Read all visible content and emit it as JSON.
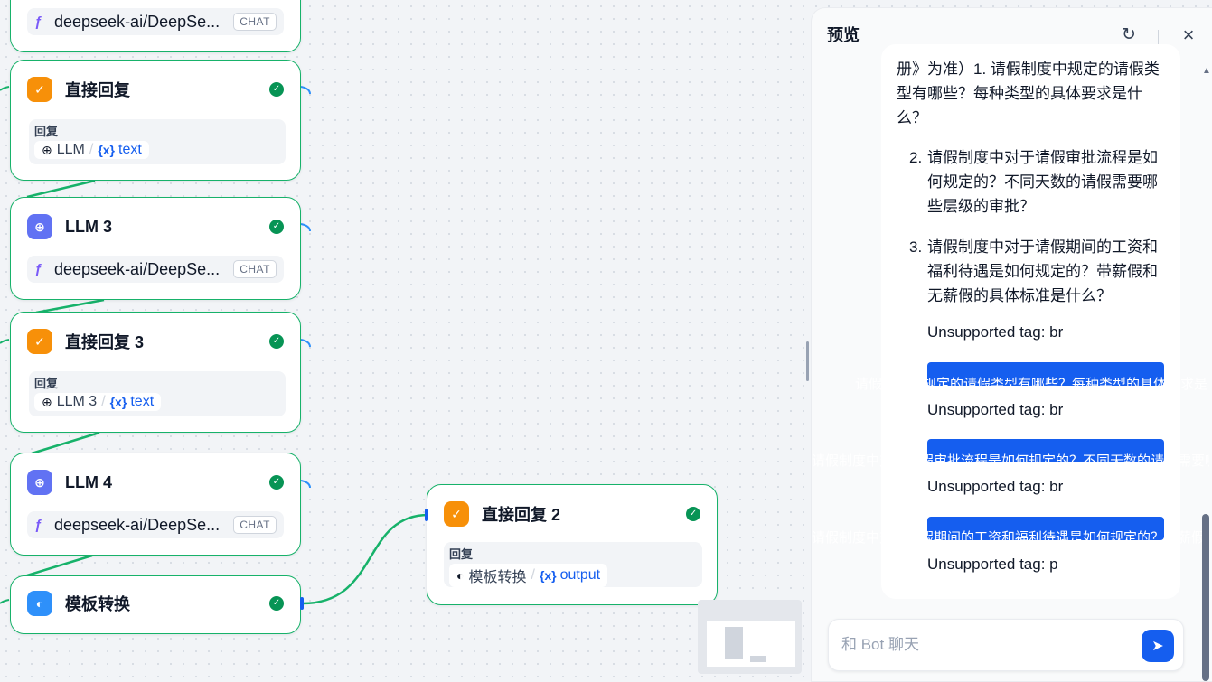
{
  "colors": {
    "accent": "#155eef",
    "success": "#17b26a",
    "answer_icon": "#f79009",
    "llm_icon": "#6172f3",
    "template_icon": "#2e90fa"
  },
  "nodes": {
    "llm_top": {
      "model": "deepseek-ai/DeepSe...",
      "badge": "CHAT"
    },
    "answer1": {
      "title": "直接回复",
      "reply_label": "回复",
      "source": "LLM",
      "var": "text"
    },
    "llm3": {
      "title": "LLM 3",
      "model": "deepseek-ai/DeepSe...",
      "badge": "CHAT"
    },
    "answer3": {
      "title": "直接回复 3",
      "reply_label": "回复",
      "source": "LLM 3",
      "var": "text"
    },
    "llm4": {
      "title": "LLM 4",
      "model": "deepseek-ai/DeepSe...",
      "badge": "CHAT"
    },
    "template": {
      "title": "模板转换"
    },
    "answer2": {
      "title": "直接回复 2",
      "reply_label": "回复",
      "source": "模板转换",
      "var": "output"
    }
  },
  "icons": {
    "answer": "message-check-icon",
    "llm": "brain-icon",
    "template": "template-icon",
    "model": "model-brand-icon",
    "status": "check-circle-icon",
    "variable": "variable-icon"
  },
  "preview": {
    "title": "预览",
    "lines": [
      "册》为准）1. 请假制度中规定的请假类",
      "型有哪些？每种类型的具体要求是什",
      "么？"
    ],
    "item2": {
      "num": "2.",
      "lines": [
        "请假制度中对于请假审批流程是如",
        "何规定的？不同天数的请假需要哪",
        "些层级的审批？"
      ]
    },
    "item3": {
      "num": "3.",
      "lines": [
        "请假制度中对于请假期间的工资和",
        "福利待遇是如何规定的？带薪假和",
        "无薪假的具体标准是什么？"
      ]
    },
    "unsupported1": "Unsupported tag: br",
    "hl1": "请假制度中规定的请假类型有哪些？每种类型的具体要求是什",
    "unsupported2": "Unsupported tag: br",
    "hl2": "请假制度中对于请假审批流程是如何规定的？不同天数的请假需要哪",
    "unsupported3": "Unsupported tag: br",
    "hl3": "请假制度中对于请假期间的工资和福利待遇是如何规定的？带薪假和无薪假",
    "unsupported4": "Unsupported tag: p",
    "input_placeholder": "和 Bot 聊天"
  }
}
